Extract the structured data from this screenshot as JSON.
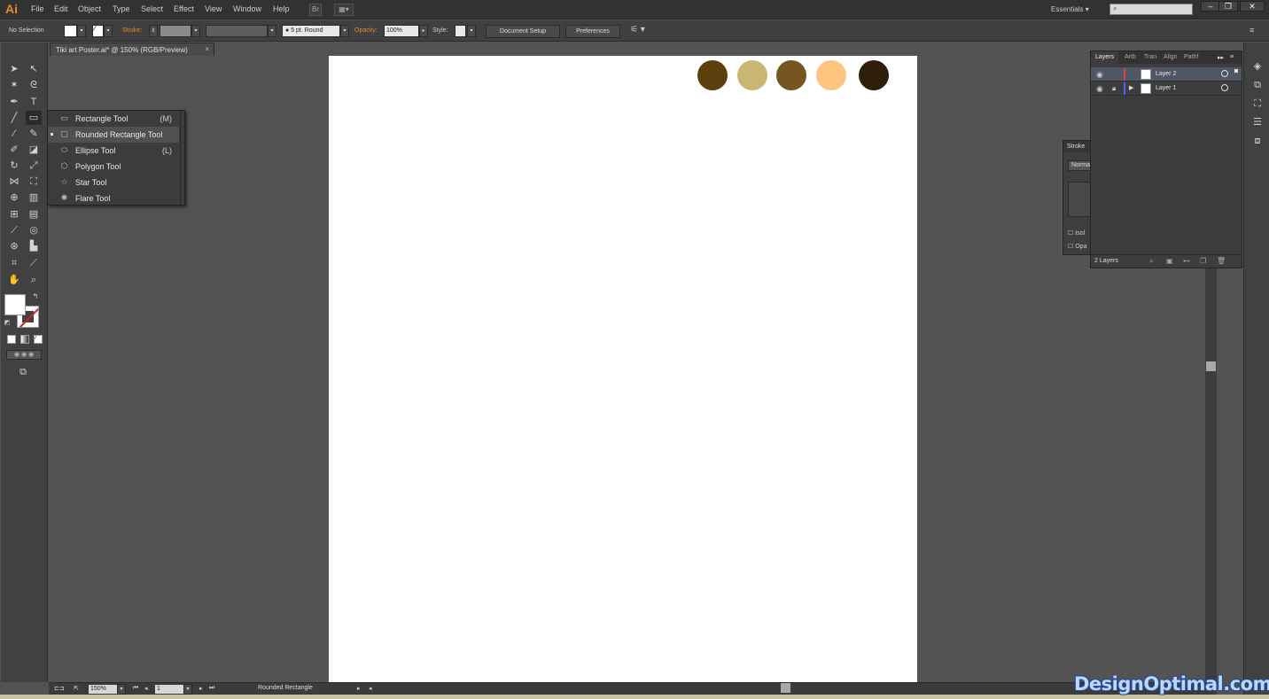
{
  "app": {
    "logo": "Ai",
    "workspace": "Essentials"
  },
  "menu": [
    "File",
    "Edit",
    "Object",
    "Type",
    "Select",
    "Effect",
    "View",
    "Window",
    "Help"
  ],
  "control_bar": {
    "selection": "No Selection",
    "stroke_label": "Stroke:",
    "brush": "5 pt. Round",
    "opacity_label": "Opacity:",
    "opacity_value": "100%",
    "style_label": "Style:",
    "document_setup": "Document Setup",
    "preferences": "Preferences"
  },
  "document": {
    "tab_title": "Tiki art Poster.ai* @ 150% (RGB/Preview)",
    "close": "×"
  },
  "palette": {
    "colors": [
      "#5c3f0c",
      "#c9b574",
      "#775420",
      "#fec581",
      "#2e1e0a"
    ]
  },
  "flyout": {
    "items": [
      {
        "icon": "rectangle-icon",
        "label": "Rectangle Tool",
        "key": "(M)",
        "selected": false
      },
      {
        "icon": "rounded-rectangle-icon",
        "label": "Rounded Rectangle Tool",
        "key": "",
        "selected": true
      },
      {
        "icon": "ellipse-icon",
        "label": "Ellipse Tool",
        "key": "(L)",
        "selected": false
      },
      {
        "icon": "polygon-icon",
        "label": "Polygon Tool",
        "key": "",
        "selected": false
      },
      {
        "icon": "star-icon",
        "label": "Star Tool",
        "key": "",
        "selected": false
      },
      {
        "icon": "flare-icon",
        "label": "Flare Tool",
        "key": "",
        "selected": false
      }
    ]
  },
  "layers_panel": {
    "tabs": [
      "Layers",
      "Artb",
      "Tran",
      "Align",
      "Pathf"
    ],
    "layers": [
      {
        "name": "Layer 2",
        "color": "#e0414a",
        "selected": true
      },
      {
        "name": "Layer 1",
        "color": "#4a66ff",
        "selected": false
      }
    ],
    "count": "2 Layers"
  },
  "stroke_panel": {
    "title": "Stroke",
    "blend": "Norma",
    "isolate": "Isol",
    "opacity": "Opa"
  },
  "status_bar": {
    "zoom": "150%",
    "artboard": "1",
    "tool": "Rounded Rectangle"
  },
  "watermark": "DesignOptimal.com"
}
